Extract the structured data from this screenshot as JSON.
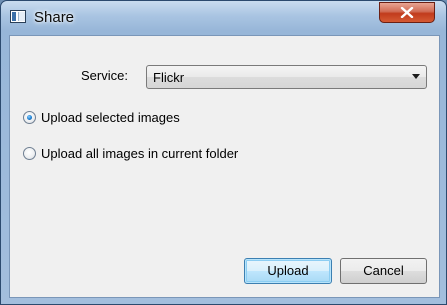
{
  "window": {
    "title": "Share",
    "close_icon": "close-icon",
    "app_icon": "app-window-icon"
  },
  "form": {
    "service_label": "Service:",
    "service_value": "Flickr",
    "radio_options": [
      {
        "label": "Upload selected images",
        "selected": true
      },
      {
        "label": "Upload all images in current folder",
        "selected": false
      }
    ]
  },
  "buttons": {
    "upload": "Upload",
    "cancel": "Cancel"
  },
  "colors": {
    "close_button": "#c13b1c",
    "default_button_border": "#3c7fb1",
    "radio_selected": "#1c7fd2"
  }
}
